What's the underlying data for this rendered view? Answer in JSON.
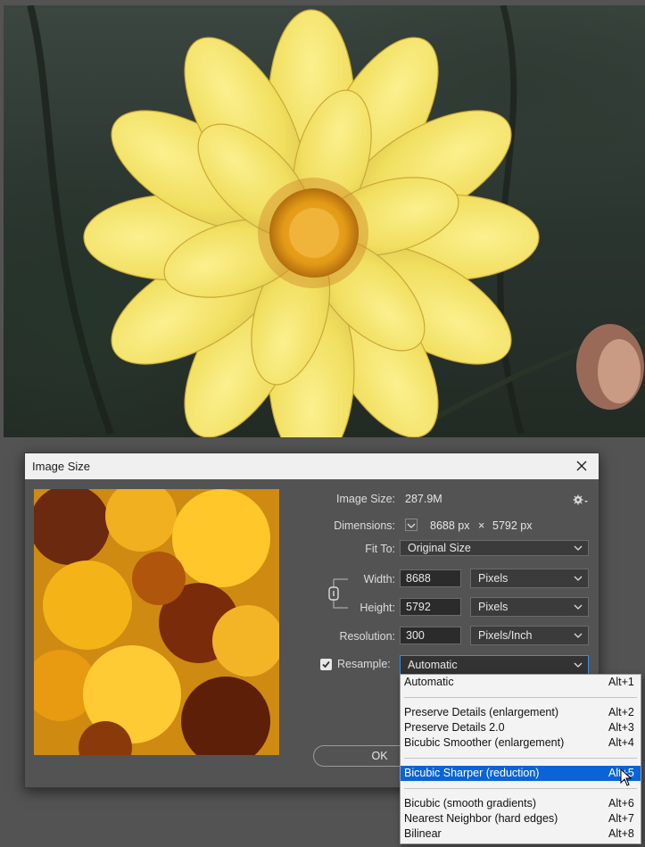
{
  "dialog": {
    "title": "Image Size",
    "image_size_label": "Image Size:",
    "image_size_value": "287.9M",
    "dimensions_label": "Dimensions:",
    "dimensions_width": "8688 px",
    "dimensions_times": "×",
    "dimensions_height": "5792 px",
    "fit_to_label": "Fit To:",
    "fit_to_value": "Original Size",
    "width_label": "Width:",
    "width_value": "8688",
    "width_unit": "Pixels",
    "height_label": "Height:",
    "height_value": "5792",
    "height_unit": "Pixels",
    "resolution_label": "Resolution:",
    "resolution_value": "300",
    "resolution_unit": "Pixels/Inch",
    "resample_label": "Resample:",
    "resample_checked": true,
    "resample_value": "Automatic",
    "ok_label": "OK"
  },
  "resample_menu": {
    "items": [
      {
        "label": "Automatic",
        "shortcut": "Alt+1"
      },
      {
        "label": "Preserve Details (enlargement)",
        "shortcut": "Alt+2"
      },
      {
        "label": "Preserve Details 2.0",
        "shortcut": "Alt+3"
      },
      {
        "label": "Bicubic Smoother (enlargement)",
        "shortcut": "Alt+4"
      },
      {
        "label": "Bicubic Sharper (reduction)",
        "shortcut": "Alt+5",
        "selected": true
      },
      {
        "label": "Bicubic (smooth gradients)",
        "shortcut": "Alt+6"
      },
      {
        "label": "Nearest Neighbor (hard edges)",
        "shortcut": "Alt+7"
      },
      {
        "label": "Bilinear",
        "shortcut": "Alt+8"
      }
    ]
  },
  "colors": {
    "dialog_bg": "#535353",
    "accent": "#0a64d6",
    "petal": "#f3e064",
    "flower_center": "#e8a21a"
  }
}
